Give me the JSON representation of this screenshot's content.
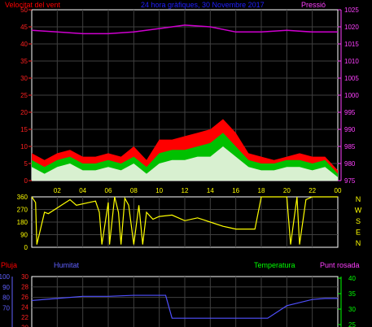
{
  "header": {
    "wind_speed_label": "Velocitat del vent",
    "title": "24 hora gràfiques, 30 Novembre 2017",
    "pressure_label": "Pressió"
  },
  "bottom_header": {
    "rain_label": "Pluja",
    "humidity_label": "Humitat",
    "temperature_label": "Temperatura",
    "dewpoint_label": "Punt rosada"
  },
  "direction_letters": [
    "N",
    "W",
    "S",
    "E",
    "N"
  ],
  "colors": {
    "wind_gust": "#ff0000",
    "wind_avg": "#00c000",
    "wind_min": "#ffffff",
    "pressure": "#d000d0",
    "direction": "#ffff00",
    "humidity": "#5050ff",
    "rain": "#ff0000",
    "temperature": "#00ff00",
    "dewpoint": "#ff40ff"
  },
  "chart_data": [
    {
      "type": "area",
      "title": "24 hora gràfiques, 30 Novembre 2017",
      "left_axis": {
        "label": "Velocitat del vent",
        "ylim": [
          0,
          50
        ],
        "ticks": [
          0,
          5,
          10,
          15,
          20,
          25,
          30,
          35,
          40,
          45,
          50
        ]
      },
      "right_axis": {
        "label": "Pressió",
        "ylim": [
          975,
          1025
        ],
        "ticks": [
          975,
          980,
          985,
          990,
          995,
          1000,
          1005,
          1010,
          1015,
          1020,
          1025
        ]
      },
      "x_tick_labels": [
        "02",
        "04",
        "06",
        "08",
        "10",
        "12",
        "14",
        "16",
        "18",
        "20",
        "22",
        "00"
      ],
      "x_ticks": [
        2,
        4,
        6,
        8,
        10,
        12,
        14,
        16,
        18,
        20,
        22,
        24
      ],
      "xlim": [
        0,
        24
      ],
      "series": [
        {
          "name": "Pressió",
          "axis": "right",
          "x": [
            0,
            2,
            4,
            6,
            8,
            10,
            12,
            14,
            16,
            18,
            20,
            22,
            24
          ],
          "values": [
            1019,
            1018.5,
            1018,
            1018,
            1018.5,
            1019.5,
            1020.5,
            1020,
            1018.5,
            1018.5,
            1019,
            1018.5,
            1018.5
          ]
        },
        {
          "name": "gust",
          "axis": "left",
          "x": [
            0,
            1,
            2,
            3,
            4,
            5,
            6,
            7,
            8,
            9,
            10,
            11,
            12,
            13,
            14,
            15,
            16,
            17,
            18,
            19,
            20,
            21,
            22,
            23,
            24
          ],
          "values": [
            8,
            6,
            8,
            9,
            7,
            7,
            8,
            7,
            10,
            6,
            12,
            12,
            13,
            14,
            15,
            18,
            14,
            8,
            7,
            6,
            7,
            8,
            7,
            7,
            3
          ]
        },
        {
          "name": "average",
          "axis": "left",
          "x": [
            0,
            1,
            2,
            3,
            4,
            5,
            6,
            7,
            8,
            9,
            10,
            11,
            12,
            13,
            14,
            15,
            16,
            17,
            18,
            19,
            20,
            21,
            22,
            23,
            24
          ],
          "values": [
            6,
            4,
            6,
            7,
            5,
            5,
            6,
            5,
            7,
            4,
            8,
            9,
            9,
            10,
            11,
            14,
            10,
            6,
            5,
            5,
            6,
            6,
            5,
            6,
            2
          ]
        },
        {
          "name": "minimum",
          "axis": "left",
          "x": [
            0,
            1,
            2,
            3,
            4,
            5,
            6,
            7,
            8,
            9,
            10,
            11,
            12,
            13,
            14,
            15,
            16,
            17,
            18,
            19,
            20,
            21,
            22,
            23,
            24
          ],
          "values": [
            4,
            2,
            4,
            5,
            3,
            3,
            4,
            3,
            5,
            2,
            5,
            6,
            6,
            7,
            7,
            10,
            7,
            4,
            3,
            3,
            4,
            4,
            3,
            4,
            1
          ]
        }
      ]
    },
    {
      "type": "line",
      "left_axis": {
        "ylim": [
          0,
          360
        ],
        "ticks": [
          0,
          90,
          180,
          270,
          360
        ]
      },
      "right_axis": {
        "tick_labels": [
          "N",
          "W",
          "S",
          "E",
          "N"
        ]
      },
      "xlim": [
        0,
        24
      ],
      "series": [
        {
          "name": "direction",
          "x": [
            0,
            0.3,
            0.4,
            1,
            1.3,
            3,
            3.5,
            5,
            5.3,
            5.5,
            6,
            6.1,
            6.5,
            6.8,
            7,
            7.3,
            7.6,
            8,
            8.4,
            8.7,
            9,
            9.5,
            10,
            11,
            12,
            13,
            14,
            15,
            15.5,
            16,
            17,
            17.5,
            18,
            18.8,
            19,
            19.5,
            20,
            20.3,
            20.8,
            21,
            21.5,
            22,
            23,
            24
          ],
          "values": [
            360,
            320,
            20,
            250,
            240,
            340,
            300,
            330,
            250,
            20,
            320,
            20,
            360,
            250,
            20,
            350,
            300,
            20,
            300,
            20,
            250,
            200,
            220,
            230,
            190,
            210,
            180,
            150,
            140,
            130,
            130,
            130,
            360,
            360,
            360,
            360,
            360,
            20,
            360,
            20,
            340,
            360,
            360,
            360
          ]
        }
      ]
    },
    {
      "type": "line",
      "left_axis": {
        "label": "Humitat",
        "ticks_visible": [
          100,
          90,
          80,
          70
        ]
      },
      "second_axis": {
        "label": "Pluja",
        "ticks_visible": [
          30,
          28,
          26,
          24,
          22,
          20
        ]
      },
      "right_axis": {
        "label": "Temperatura",
        "ticks_visible": [
          40,
          35,
          30,
          25
        ]
      },
      "series": [
        {
          "name": "Humitat",
          "x": [
            0,
            1,
            2,
            4,
            6,
            8,
            9,
            10.5,
            11,
            18.5,
            20,
            22,
            23,
            24
          ],
          "values": [
            77,
            78,
            79,
            81,
            81,
            82,
            82,
            82,
            60,
            60,
            72,
            78,
            79,
            79
          ]
        }
      ]
    }
  ]
}
